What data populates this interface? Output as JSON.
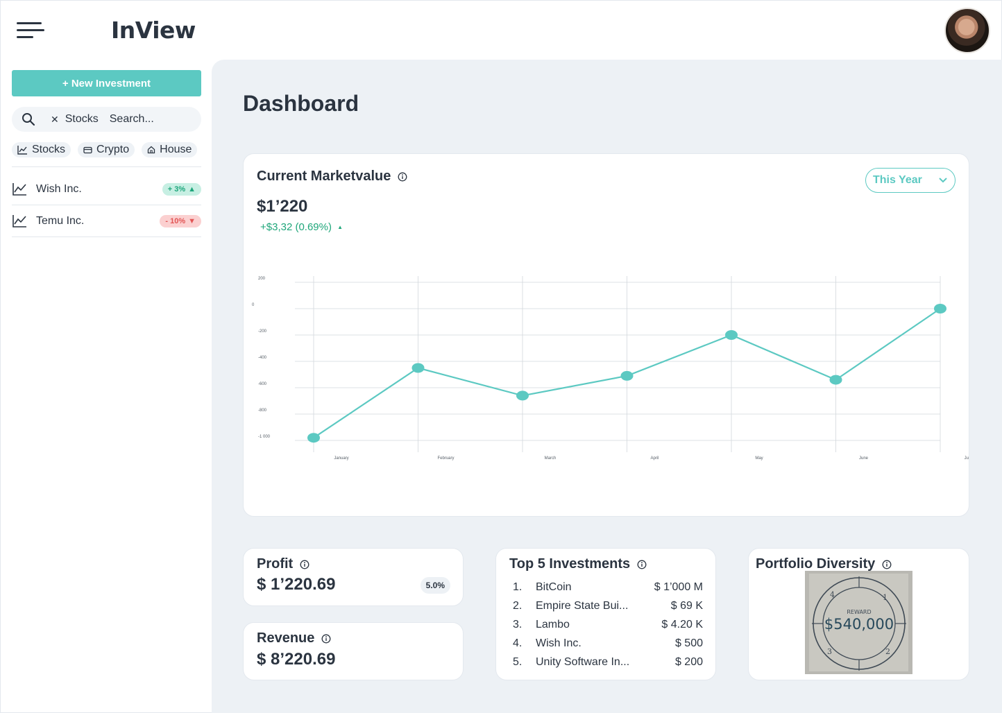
{
  "app": {
    "title": "InView"
  },
  "sidebar": {
    "new_button": "+ New Investment",
    "search": {
      "chip": "Stocks",
      "placeholder": "Search..."
    },
    "filters": [
      {
        "label": "Stocks",
        "icon": "chart-line-icon"
      },
      {
        "label": "Crypto",
        "icon": "card-icon"
      },
      {
        "label": "House",
        "icon": "house-icon"
      }
    ],
    "items": [
      {
        "label": "Wish Inc.",
        "badge": "+ 3%",
        "trend": "up",
        "icon": "chart-line-icon"
      },
      {
        "label": "Temu Inc.",
        "badge": "- 10%",
        "trend": "down",
        "icon": "chart-line-icon"
      }
    ]
  },
  "main": {
    "title": "Dashboard",
    "market": {
      "title": "Current Marketvalue",
      "value": "$1’220",
      "change": "+$3,32 (0.69%)",
      "range": "This Year"
    },
    "profit": {
      "title": "Profit",
      "value": "$ 1’220.69",
      "pct": "5.0%"
    },
    "revenue": {
      "title": "Revenue",
      "value": "$ 8’220.69"
    },
    "top5": {
      "title": "Top 5 Investments",
      "rows": [
        {
          "idx": "1.",
          "name": "BitCoin",
          "amount": "$ 1’000 M"
        },
        {
          "idx": "2.",
          "name": "Empire State Bui...",
          "amount": "$ 69 K"
        },
        {
          "idx": "3.",
          "name": "Lambo",
          "amount": "$ 4.20 K"
        },
        {
          "idx": "4.",
          "name": "Wish Inc.",
          "amount": "$ 500"
        },
        {
          "idx": "5.",
          "name": "Unity Software In...",
          "amount": "$ 200"
        }
      ]
    },
    "diversity": {
      "title": "Portfolio Diversity",
      "image_text": {
        "top": "REWARD",
        "amount": "$540,000",
        "marks": [
          "4",
          "1",
          "3",
          "2"
        ]
      }
    }
  },
  "chart_data": {
    "type": "line",
    "title": "",
    "xlabel": "",
    "ylabel": "",
    "categories": [
      "January",
      "February",
      "March",
      "April",
      "May",
      "June",
      "July"
    ],
    "y_ticks": [
      "200",
      "0",
      "-200",
      "-400",
      "-600",
      "-800",
      "-1 000"
    ],
    "ylim": [
      -1000,
      200
    ],
    "grid": true,
    "color": "#5cc9c2",
    "series": [
      {
        "values": [
          -980,
          -450,
          -660,
          -510,
          -200,
          -540,
          0
        ]
      }
    ]
  }
}
